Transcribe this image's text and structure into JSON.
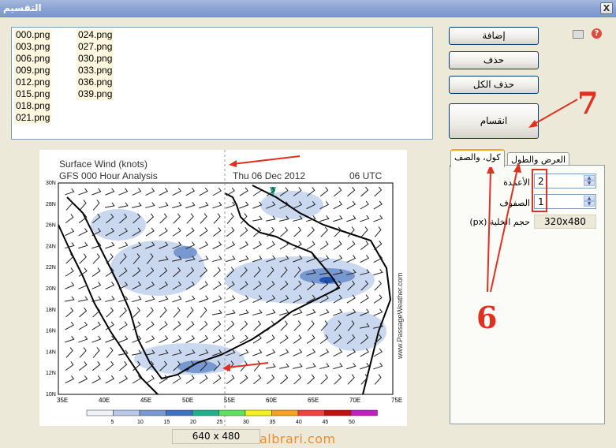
{
  "window": {
    "title": "التقسيم",
    "close": "X"
  },
  "files": {
    "col1": [
      "000.png",
      "003.png",
      "006.png",
      "009.png",
      "012.png",
      "015.png",
      "018.png",
      "021.png"
    ],
    "col2": [
      "024.png",
      "027.png",
      "030.png",
      "033.png",
      "036.png",
      "039.png"
    ]
  },
  "buttons": {
    "add": "إضافة",
    "delete": "حذف",
    "delete_all": "حذف الكل",
    "split": "انقسام"
  },
  "tabs": {
    "cols_rows": "كول، والصف",
    "width_height": "العرض والطول"
  },
  "settings": {
    "columns_label": "الأعمدة",
    "columns_value": "2",
    "rows_label": "الصفوف",
    "rows_value": "1",
    "cell_size_label": "حجم الخلية (px)",
    "cell_size_value": "320x480"
  },
  "annotations": {
    "step7": "7",
    "step6": "6"
  },
  "map": {
    "title": "Surface Wind (knots)",
    "subtitle": "GFS 000 Hour Analysis",
    "date": "Thu 06 Dec 2012",
    "time": "06 UTC",
    "credit": "www.PassageWeather.com",
    "lat_labels": [
      "30N",
      "28N",
      "26N",
      "24N",
      "22N",
      "20N",
      "18N",
      "16N",
      "14N",
      "12N",
      "10N"
    ],
    "lon_labels": [
      "35E",
      "40E",
      "45E",
      "50E",
      "55E",
      "60E",
      "65E",
      "70E",
      "75E"
    ],
    "legend_labels": [
      "5",
      "10",
      "15",
      "20",
      "25",
      "30",
      "35",
      "40",
      "45",
      "50"
    ],
    "legend_colors": [
      "#f0f0f8",
      "#b8c8e8",
      "#7898d0",
      "#4070c0",
      "#20b090",
      "#60e060",
      "#f0f020",
      "#f8a020",
      "#f04040",
      "#c01010",
      "#c020c0"
    ]
  },
  "status": {
    "image_size": "640 x 480"
  },
  "watermark": "albrari.com"
}
